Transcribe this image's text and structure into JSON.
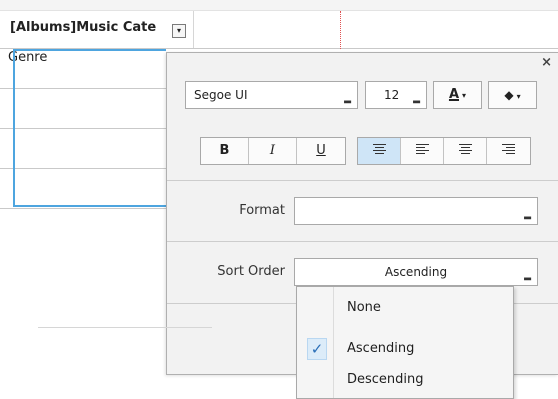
{
  "grid": {
    "column_title": "[Albums]Music Cate",
    "rows": [
      "Genre",
      "",
      "",
      ""
    ],
    "header_dropdown_glyph": "▾"
  },
  "format_popup": {
    "close_glyph": "×",
    "font_name": "Segoe UI",
    "font_size": "12",
    "font_color_label": "A",
    "fill_color_glyph": "◆",
    "bold_label": "B",
    "italic_label": "I",
    "underline_label": "U",
    "format_label": "Format",
    "format_value": "",
    "sort_order_label": "Sort Order",
    "sort_order_value": "Ascending",
    "accent_color": "#4ea5df",
    "guide_color": "#e05050"
  },
  "sort_menu": {
    "items": [
      {
        "label": "None",
        "checked": false
      },
      {
        "label": "Ascending",
        "checked": true
      },
      {
        "label": "Descending",
        "checked": false
      }
    ],
    "check_glyph": "✓"
  }
}
